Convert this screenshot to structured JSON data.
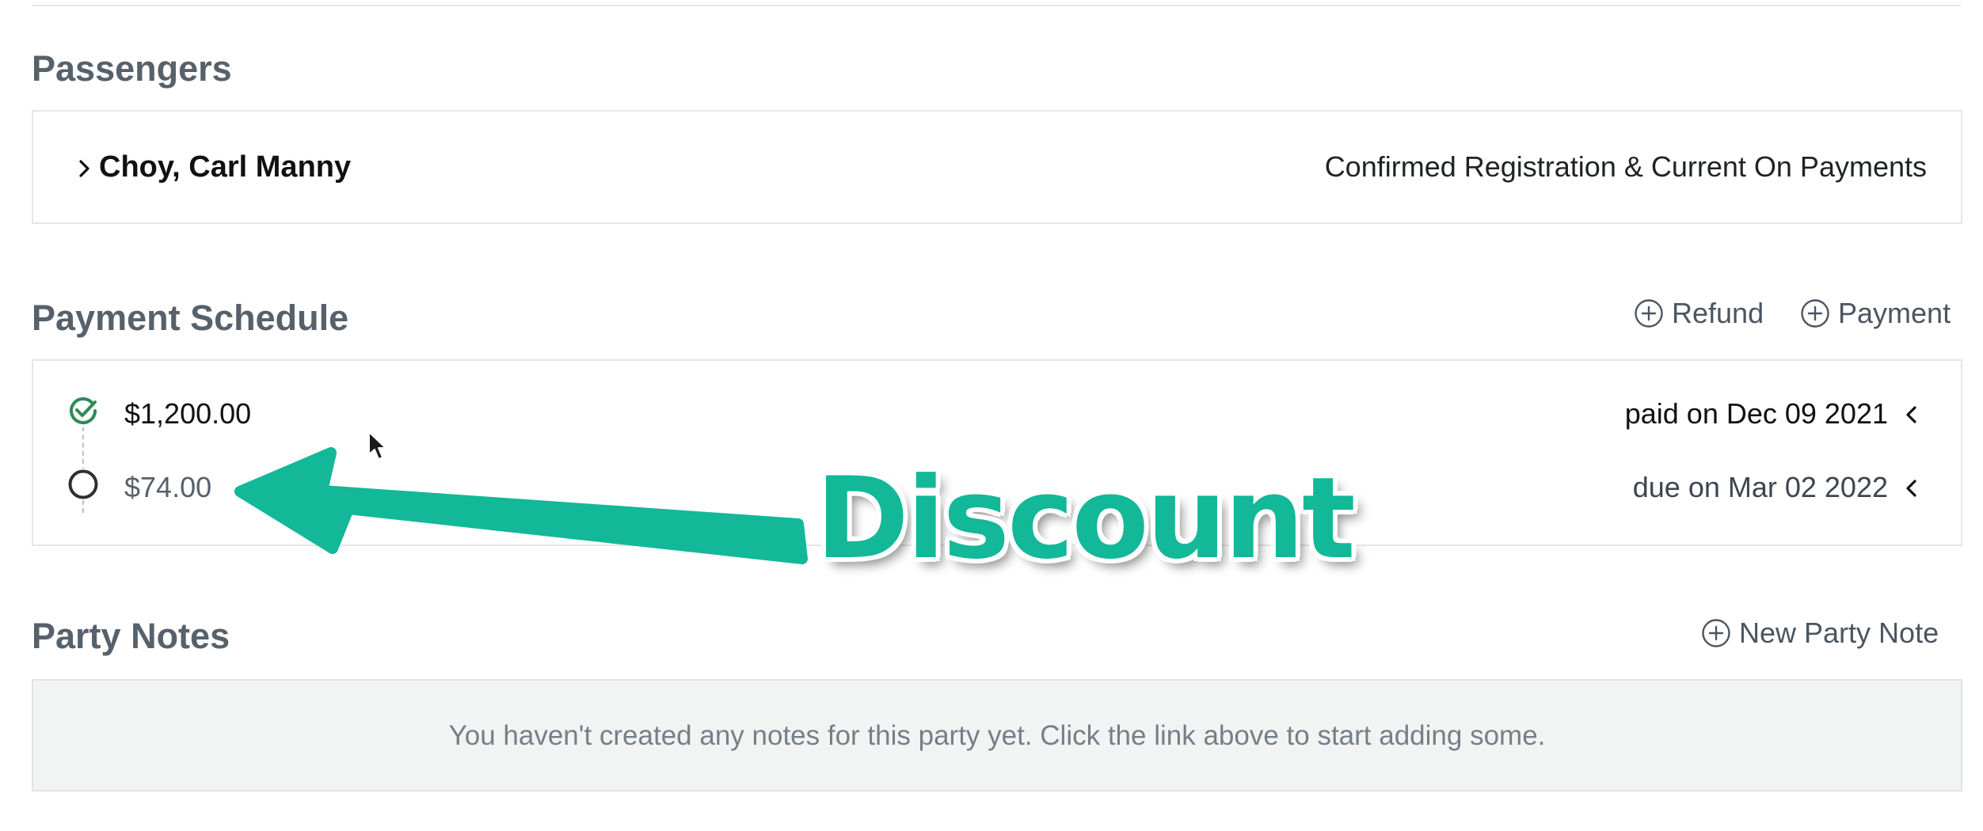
{
  "passengers": {
    "title": "Passengers",
    "items": [
      {
        "name": "Choy, Carl Manny",
        "status": "Confirmed Registration & Current On Payments"
      }
    ]
  },
  "payment_schedule": {
    "title": "Payment Schedule",
    "refund_label": "Refund",
    "payment_label": "Payment",
    "items": [
      {
        "amount": "$1,200.00",
        "status": "paid on Dec 09 2021",
        "state": "paid"
      },
      {
        "amount": "$74.00",
        "status": "due on Mar 02 2022",
        "state": "due"
      }
    ]
  },
  "party_notes": {
    "title": "Party Notes",
    "new_note_label": "New Party Note",
    "empty_message": "You haven't created any notes for this party yet. Click the link above to start adding some."
  },
  "annotation": {
    "label": "Discount",
    "color": "#12b898"
  },
  "icons": [
    "chevron-right-icon",
    "plus-circle-icon",
    "check-circle-icon",
    "open-circle-icon",
    "chevron-left-icon",
    "mouse-cursor-icon"
  ],
  "colors": {
    "paid_green": "#2e8b57",
    "heading_gray": "#56616b",
    "border": "#e3e7ea"
  }
}
